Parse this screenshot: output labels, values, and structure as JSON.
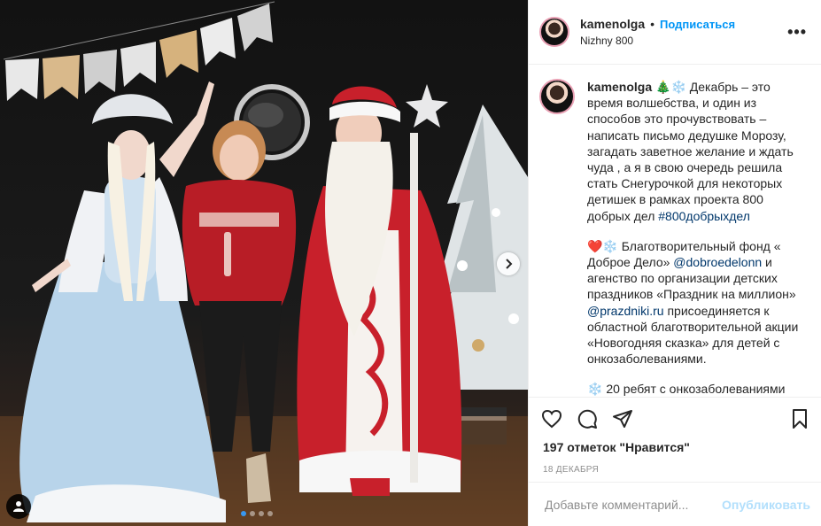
{
  "header": {
    "username": "kamenolga",
    "separator": "•",
    "follow_label": "Подписаться",
    "location": "Nizhny 800",
    "more_label": "•••"
  },
  "caption": {
    "username": "kamenolga",
    "paragraphs": [
      " 🎄❄️ Декабрь – это время волшебства, и один из способов это прочувствовать – написать письмо дедушке Морозу, загадать заветное желание и ждать чуда , а я в свою очередь решила стать Снегурочкой для некоторых детишек в рамках проекта 800 добрых дел ",
      "#800добрыхдел"
    ],
    "p2_prefix": "❤️❄️ Благотворительный фонд « Доброе Дело» ",
    "p2_mention1": "@dobroedelonn",
    "p2_mid": " и агенство по организации детских праздников «Праздник на миллион» ",
    "p2_mention2": "@prazdniki.ru",
    "p2_suffix": " присоединяется к областной благотворительной акции «Новогодняя сказка» для детей с онкозаболеваниями.",
    "p3": "❄️ 20 ребят с онкозаболеваниями"
  },
  "actions": {
    "like_icon": "heart-icon",
    "comment_icon": "comment-icon",
    "share_icon": "paper-plane-icon",
    "save_icon": "bookmark-icon"
  },
  "likes_text": "197 отметок \"Нравится\"",
  "date_text": "18 декабря",
  "comment": {
    "placeholder": "Добавьте комментарий...",
    "publish_label": "Опубликовать"
  },
  "carousel": {
    "count": 4,
    "active_index": 0
  },
  "colors": {
    "accent": "#0095f6",
    "publish_disabled": "#b2dffc",
    "muted": "#8e8e8e"
  }
}
